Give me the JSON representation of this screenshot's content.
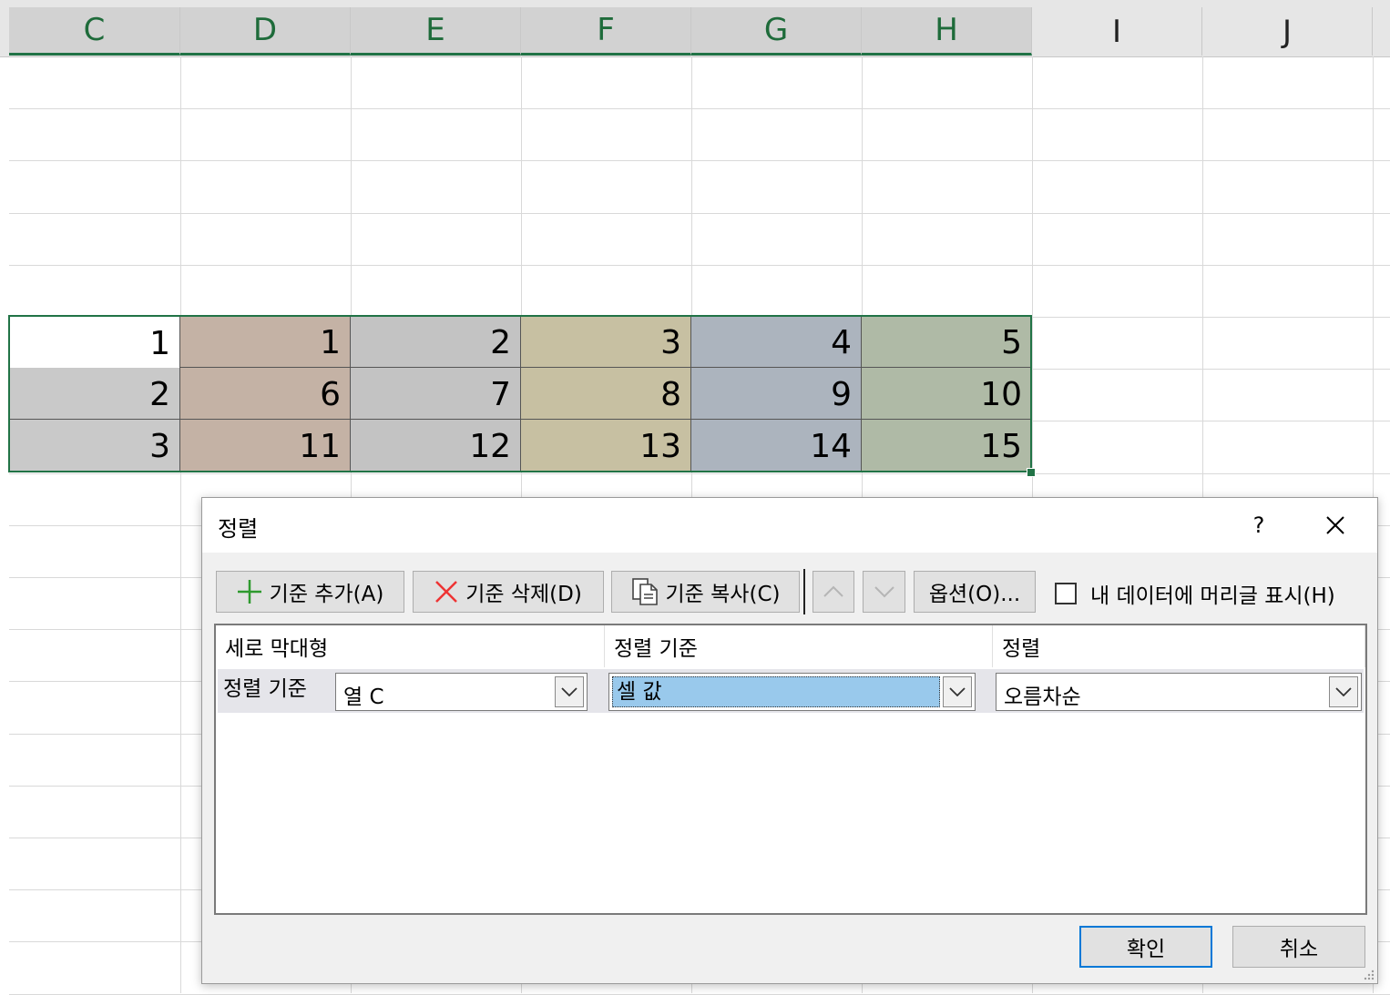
{
  "spreadsheet": {
    "column_headers": [
      "C",
      "D",
      "E",
      "F",
      "G",
      "H",
      "I",
      "J"
    ],
    "selected_columns": [
      "C",
      "D",
      "E",
      "F",
      "G",
      "H"
    ],
    "rows": [
      [
        "1",
        "1",
        "2",
        "3",
        "4",
        "5"
      ],
      [
        "2",
        "6",
        "7",
        "8",
        "9",
        "10"
      ],
      [
        "3",
        "11",
        "12",
        "13",
        "14",
        "15"
      ]
    ],
    "column_fills": [
      "#ffffff",
      "#c4b2a5",
      "#c3c3c3",
      "#c7c0a2",
      "#acb4be",
      "#afbaa6"
    ],
    "first_column_fills": [
      "#ffffff",
      "#c9c9c9",
      "#c9c9c9"
    ],
    "selection_color": "#217346"
  },
  "dialog": {
    "title": "정렬",
    "help_label": "?",
    "toolbar": {
      "add_level": "기준 추가(A)",
      "delete_level": "기준 삭제(D)",
      "copy_level": "기준 복사(C)",
      "options": "옵션(O)...",
      "header_checkbox_label": "내 데이터에 머리글 표시(H)",
      "header_checkbox_checked": false
    },
    "list": {
      "headers": [
        "세로 막대형",
        "정렬 기준",
        "정렬"
      ],
      "row": {
        "label": "정렬 기준",
        "column_value": "열 C",
        "sort_on_value": "셀 값",
        "order_value": "오름차순"
      }
    },
    "ok_label": "확인",
    "cancel_label": "취소",
    "accent_color": "#0078d7"
  }
}
